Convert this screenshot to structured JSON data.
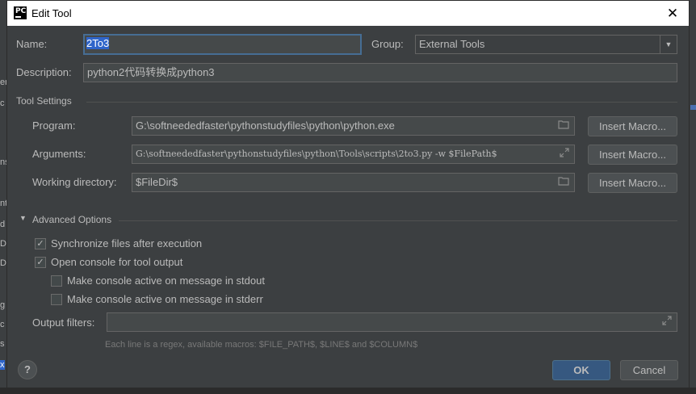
{
  "window": {
    "title": "Edit Tool",
    "close_icon": "✕",
    "app_icon": "PC"
  },
  "form": {
    "name_label": "Name:",
    "name_value": "2To3",
    "group_label": "Group:",
    "group_value": "External Tools",
    "description_label": "Description:",
    "description_value": "python2代码转换成python3"
  },
  "tool_settings": {
    "title": "Tool Settings",
    "program_label": "Program:",
    "program_value": "G:\\softneededfaster\\pythonstudyfiles\\python\\python.exe",
    "arguments_label": "Arguments:",
    "arguments_value": "G:\\softneededfaster\\pythonstudyfiles\\python\\Tools\\scripts\\2to3.py -w $FilePath$",
    "working_dir_label": "Working directory:",
    "working_dir_value": "$FileDir$",
    "insert_macro_label": "Insert Macro..."
  },
  "advanced": {
    "title": "Advanced Options",
    "sync_label": "Synchronize files after execution",
    "sync_checked": true,
    "console_label": "Open console for tool output",
    "console_checked": true,
    "stdout_label": "Make console active on message in stdout",
    "stdout_checked": false,
    "stderr_label": "Make console active on message in stderr",
    "stderr_checked": false,
    "output_filters_label": "Output filters:",
    "output_filters_value": "",
    "hint": "Each line is a regex, available macros: $FILE_PATH$, $LINE$ and $COLUMN$"
  },
  "footer": {
    "help_label": "?",
    "ok_label": "OK",
    "cancel_label": "Cancel"
  },
  "background_fragments": [
    "er",
    "c",
    "ns",
    "nt",
    "d",
    "De",
    "De",
    "g",
    "c",
    "s",
    "x"
  ],
  "colors": {
    "accent": "#365880",
    "selection": "#2f65ca",
    "focus": "#466d94",
    "panel": "#3c3f41"
  },
  "icons": {
    "folder": "folder-icon",
    "expand": "expand-icon",
    "checkbox_check": "✓",
    "dropdown": "chevron-down-icon",
    "collapse": "triangle-down-icon"
  }
}
